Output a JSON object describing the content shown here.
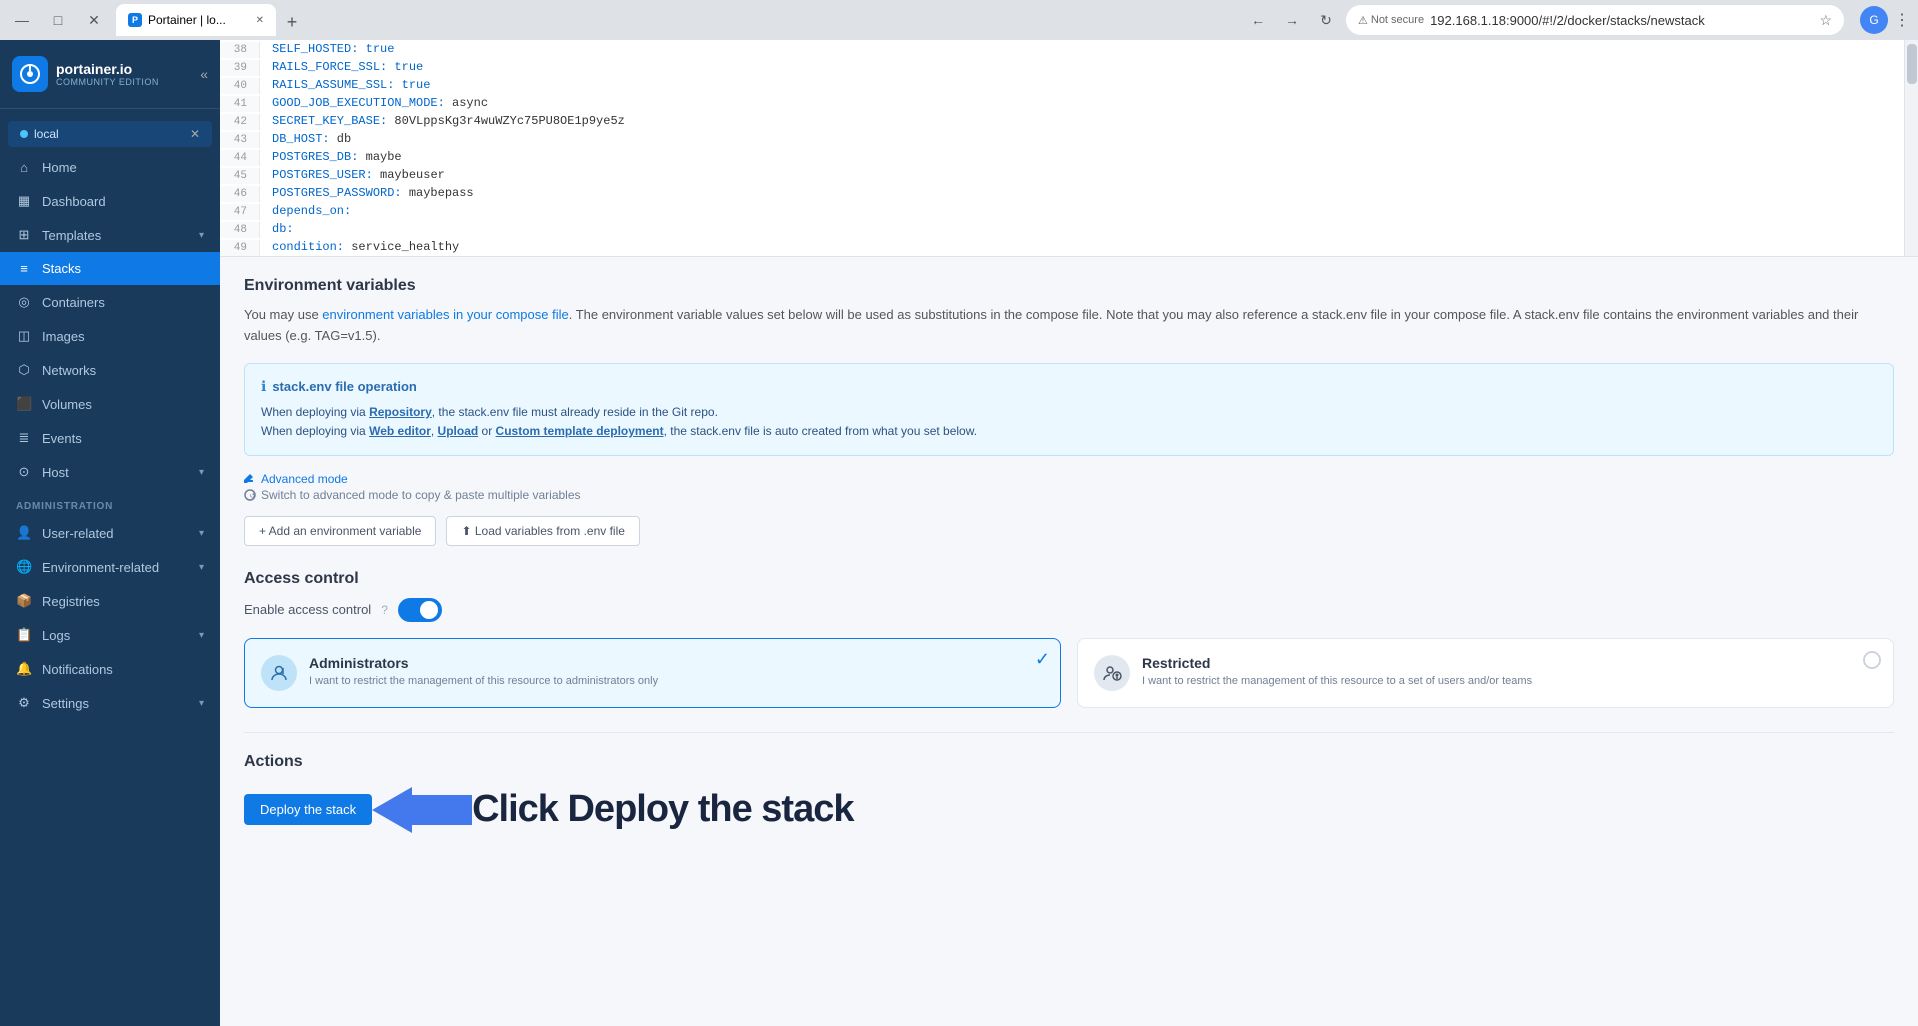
{
  "browser": {
    "tab_title": "Portainer | lo...",
    "url": "192.168.1.18:9000/#!/2/docker/stacks/newstack",
    "not_secure_label": "Not secure",
    "favicon_letter": "P"
  },
  "sidebar": {
    "logo_main": "portainer.io",
    "logo_sub": "Community Edition",
    "endpoint_name": "local",
    "nav_items": [
      {
        "id": "home",
        "label": "Home",
        "icon": "⌂"
      },
      {
        "id": "dashboard",
        "label": "Dashboard",
        "icon": "▦"
      },
      {
        "id": "templates",
        "label": "Templates",
        "icon": "⊞",
        "hasChevron": true
      },
      {
        "id": "stacks",
        "label": "Stacks",
        "icon": "≡",
        "active": true
      },
      {
        "id": "containers",
        "label": "Containers",
        "icon": "◎"
      },
      {
        "id": "images",
        "label": "Images",
        "icon": "◫"
      },
      {
        "id": "networks",
        "label": "Networks",
        "icon": "⬡"
      },
      {
        "id": "volumes",
        "label": "Volumes",
        "icon": "⬛"
      },
      {
        "id": "events",
        "label": "Events",
        "icon": "≣"
      },
      {
        "id": "host",
        "label": "Host",
        "icon": "⊙",
        "hasChevron": true
      }
    ],
    "admin_section": "Administration",
    "admin_items": [
      {
        "id": "user-related",
        "label": "User-related",
        "icon": "👤",
        "hasChevron": true
      },
      {
        "id": "environment-related",
        "label": "Environment-related",
        "icon": "🌐",
        "hasChevron": true
      },
      {
        "id": "registries",
        "label": "Registries",
        "icon": "📦"
      },
      {
        "id": "logs",
        "label": "Logs",
        "icon": "📋",
        "hasChevron": true
      },
      {
        "id": "notifications",
        "label": "Notifications",
        "icon": "🔔"
      },
      {
        "id": "settings",
        "label": "Settings",
        "icon": "⚙",
        "hasChevron": true
      }
    ]
  },
  "code": {
    "lines": [
      {
        "num": "38",
        "content": "    SELF_HOSTED: true"
      },
      {
        "num": "39",
        "content": "    RAILS_FORCE_SSL: true"
      },
      {
        "num": "40",
        "content": "    RAILS_ASSUME_SSL: true"
      },
      {
        "num": "41",
        "content": "    GOOD_JOB_EXECUTION_MODE: async"
      },
      {
        "num": "42",
        "content": "    SECRET_KEY_BASE: 80VLppsKg3r4wuWZYc75PU8OE1p9ye5z"
      },
      {
        "num": "43",
        "content": "    DB_HOST: db"
      },
      {
        "num": "44",
        "content": "    POSTGRES_DB: maybe"
      },
      {
        "num": "45",
        "content": "    POSTGRES_USER: maybeuser"
      },
      {
        "num": "46",
        "content": "    POSTGRES_PASSWORD: maybepass"
      },
      {
        "num": "47",
        "content": "  depends_on:"
      },
      {
        "num": "48",
        "content": "    db:"
      },
      {
        "num": "49",
        "content": "      condition: service_healthy"
      }
    ]
  },
  "env_vars": {
    "title": "Environment variables",
    "description_start": "You may use ",
    "description_link": "environment variables in your compose file",
    "description_end": ". The environment variable values set below will be used as substitutions in the compose file. Note that you may also reference a stack.env file in your compose file. A stack.env file contains the environment variables and their values (e.g. TAG=v1.5).",
    "info_title": "stack.env file operation",
    "info_p1": "When deploying via ",
    "info_p1_link": "Repository",
    "info_p1_end": ", the stack.env file must already reside in the Git repo.",
    "info_p2": "When deploying via ",
    "info_p2_link1": "Web editor",
    "info_p2_sep1": ", ",
    "info_p2_link2": "Upload",
    "info_p2_sep2": " or ",
    "info_p2_link3": "Custom template deployment",
    "info_p2_end": ", the stack.env file is auto created from what you set below.",
    "advanced_mode_label": "Advanced mode",
    "advanced_switch_label": "Switch to advanced mode to copy & paste multiple variables",
    "add_btn": "+ Add an environment variable",
    "load_btn": "⬆ Load variables from .env file"
  },
  "access_control": {
    "title": "Access control",
    "enable_label": "Enable access control",
    "toggle_on": true,
    "admins_title": "Administrators",
    "admins_desc": "I want to restrict the management of this resource to administrators only",
    "restricted_title": "Restricted",
    "restricted_desc": "I want to restrict the management of this resource to a set of users and/or teams"
  },
  "actions": {
    "title": "Actions",
    "deploy_btn": "Deploy the stack",
    "annotation": "Click Deploy the stack"
  }
}
